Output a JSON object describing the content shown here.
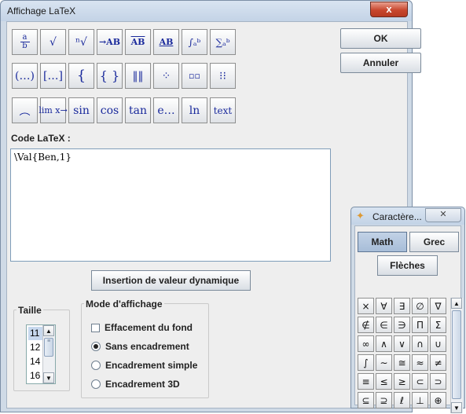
{
  "window": {
    "title": "Affichage LaTeX",
    "close": "x"
  },
  "latex_buttons": {
    "row1": [
      "a/b",
      "√",
      "ⁿ√",
      "→AB",
      "AB̅",
      "AB",
      "∫ₐᵇ",
      "∑ₐᵇ"
    ],
    "row2": [
      "(…)",
      "[…]",
      "{",
      "{ }",
      "‖‖",
      "⁘",
      "▫▫",
      "⁝⁝"
    ],
    "row3": [
      "︵",
      "lim x→",
      "sin",
      "cos",
      "tan",
      "e…",
      "ln",
      "text"
    ]
  },
  "buttons": {
    "ok": "OK",
    "cancel": "Annuler",
    "dynamic": "Insertion de valeur dynamique"
  },
  "code": {
    "label": "Code LaTeX :",
    "value": "\\Val{Ben,1}"
  },
  "size": {
    "title": "Taille",
    "items": [
      "11",
      "12",
      "14",
      "16"
    ],
    "selected": "11"
  },
  "mode": {
    "title": "Mode d'affichage",
    "checkbox": "Effacement du fond",
    "options": [
      "Sans encadrement",
      "Encadrement simple",
      "Encadrement 3D"
    ],
    "selected": "Sans encadrement"
  },
  "palette": {
    "title": "Caractère...",
    "tabs": [
      "Math",
      "Grec",
      "Flèches"
    ],
    "active_tab": "Math",
    "rows": [
      [
        "×",
        "∀",
        "∃",
        "∅",
        "∇"
      ],
      [
        "∉",
        "∈",
        "∋",
        "Π",
        "Σ"
      ],
      [
        "∞",
        "∧",
        "∨",
        "∩",
        "∪"
      ],
      [
        "∫",
        "∼",
        "≅",
        "≈",
        "≠"
      ],
      [
        "≡",
        "≤",
        "≥",
        "⊂",
        "⊃"
      ],
      [
        "⊆",
        "⊇",
        "ℓ",
        "⊥",
        "⊕"
      ]
    ]
  }
}
